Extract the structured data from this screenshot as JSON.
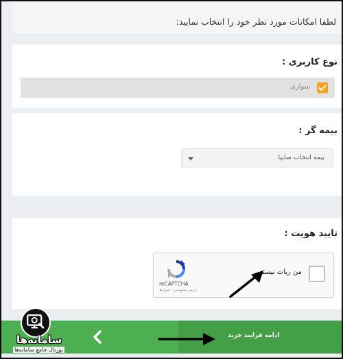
{
  "intro": {
    "text": "لطفا امکانات مورد نظر خود را انتخاب نمایید:"
  },
  "user_type": {
    "title": "نوع کاربری :",
    "option_label": "سواری",
    "option_checked": true
  },
  "insurer": {
    "title": "بیمه گر :",
    "selected": "بیمه انتخاب سایپا"
  },
  "verification": {
    "title": "تایید هویت :",
    "recaptcha": {
      "label": "من ربات نیستم",
      "brand": "reCAPTCHA",
      "terms": "حریم خصوصی - شرایط"
    }
  },
  "bottom_bar": {
    "continue_label": "ادامه فرایند خرید"
  },
  "watermark": {
    "name": "سامانه‌ها",
    "tagline": "پورتال جامع سامانه‌ها"
  },
  "colors": {
    "accent_green": "#4caf50",
    "checkbox_orange": "#f2a31f"
  },
  "icons": [
    "checkmark-icon",
    "caret-down-icon",
    "recaptcha-logo-icon",
    "chevron-left-icon",
    "arrow-annotation-icon",
    "monitor-logo-icon"
  ]
}
